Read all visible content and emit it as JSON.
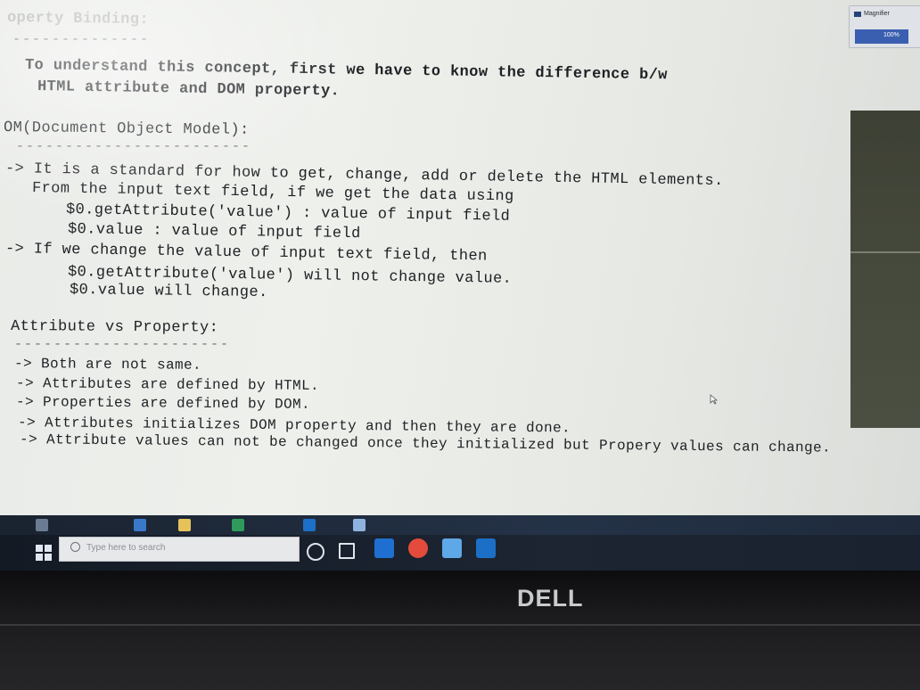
{
  "document": {
    "heading_property_binding": "operty Binding:",
    "heading_underline": "--------------",
    "intro_line1": "To understand this concept, first we have to know the difference b/w",
    "intro_line2": "HTML attribute and DOM property.",
    "dom_heading": "OM(Document Object Model):",
    "dom_underline": "------------------------",
    "dom_lines": [
      "-> It is a standard for how to get, change, add or delete the HTML elements.",
      "From the input text field, if we get the data using",
      "$0.getAttribute('value') : value of input field",
      "$0.value : value of input field",
      "-> If we change the value of input text field, then",
      "$0.getAttribute('value') will not change value.",
      "$0.value will change."
    ],
    "attr_heading": "Attribute vs Property:",
    "attr_underline": "----------------------",
    "attr_lines": [
      "-> Both are not same.",
      "-> Attributes are defined by HTML.",
      "-> Properties are defined by DOM.",
      "-> Attributes initializes DOM property and then they are done.",
      "-> Attribute values can not be changed once they initialized but Propery values can change."
    ]
  },
  "magnifier": {
    "title": "Magnifier",
    "zoom": "100%"
  },
  "taskbar": {
    "search_placeholder": "Type here to search"
  },
  "bezel": {
    "brand": "DELL"
  },
  "colors": {
    "screen_bg": "#eceeea",
    "text": "#1f2024",
    "taskbar": "#1d2533",
    "bezel": "#1c1c1e"
  }
}
